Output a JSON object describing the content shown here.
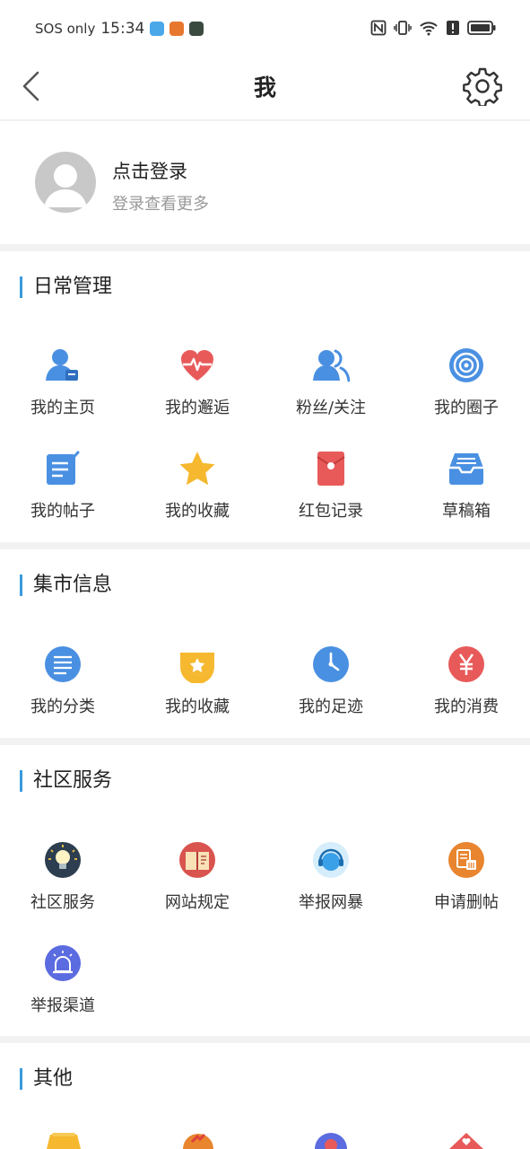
{
  "status_bar": {
    "carrier": "SOS only",
    "time": "15:34"
  },
  "navbar": {
    "title": "我",
    "back_icon": "chevron-left-icon",
    "settings_icon": "gear-icon"
  },
  "profile": {
    "login_text": "点击登录",
    "subtitle": "登录查看更多"
  },
  "sections": {
    "daily": {
      "title": "日常管理",
      "items": [
        {
          "label": "我的主页",
          "icon": "user-card-icon",
          "color": "#4a90e2"
        },
        {
          "label": "我的邂逅",
          "icon": "heartbeat-icon",
          "color": "#e85a5a"
        },
        {
          "label": "粉丝/关注",
          "icon": "users-icon",
          "color": "#4a90e2"
        },
        {
          "label": "我的圈子",
          "icon": "circles-icon",
          "color": "#4a90e2"
        },
        {
          "label": "我的帖子",
          "icon": "edit-note-icon",
          "color": "#4a90e2"
        },
        {
          "label": "我的收藏",
          "icon": "star-icon",
          "color": "#f5b82e"
        },
        {
          "label": "红包记录",
          "icon": "red-envelope-icon",
          "color": "#e85a5a"
        },
        {
          "label": "草稿箱",
          "icon": "inbox-icon",
          "color": "#4a90e2"
        }
      ]
    },
    "market": {
      "title": "集市信息",
      "items": [
        {
          "label": "我的分类",
          "icon": "list-icon",
          "color": "#4a90e2"
        },
        {
          "label": "我的收藏",
          "icon": "star-box-icon",
          "color": "#f5b82e"
        },
        {
          "label": "我的足迹",
          "icon": "clock-icon",
          "color": "#4a90e2"
        },
        {
          "label": "我的消费",
          "icon": "yen-icon",
          "color": "#e85a5a"
        }
      ]
    },
    "community": {
      "title": "社区服务",
      "items": [
        {
          "label": "社区服务",
          "icon": "lightbulb-icon",
          "color": "#2c3e50"
        },
        {
          "label": "网站规定",
          "icon": "rulebook-icon",
          "color": "#d9534f"
        },
        {
          "label": "举报网暴",
          "icon": "headset-icon",
          "color": "#3aa0e8"
        },
        {
          "label": "申请删帖",
          "icon": "delete-doc-icon",
          "color": "#e8852e"
        },
        {
          "label": "举报渠道",
          "icon": "alarm-icon",
          "color": "#5b6be0"
        }
      ]
    },
    "other": {
      "title": "其他"
    }
  }
}
